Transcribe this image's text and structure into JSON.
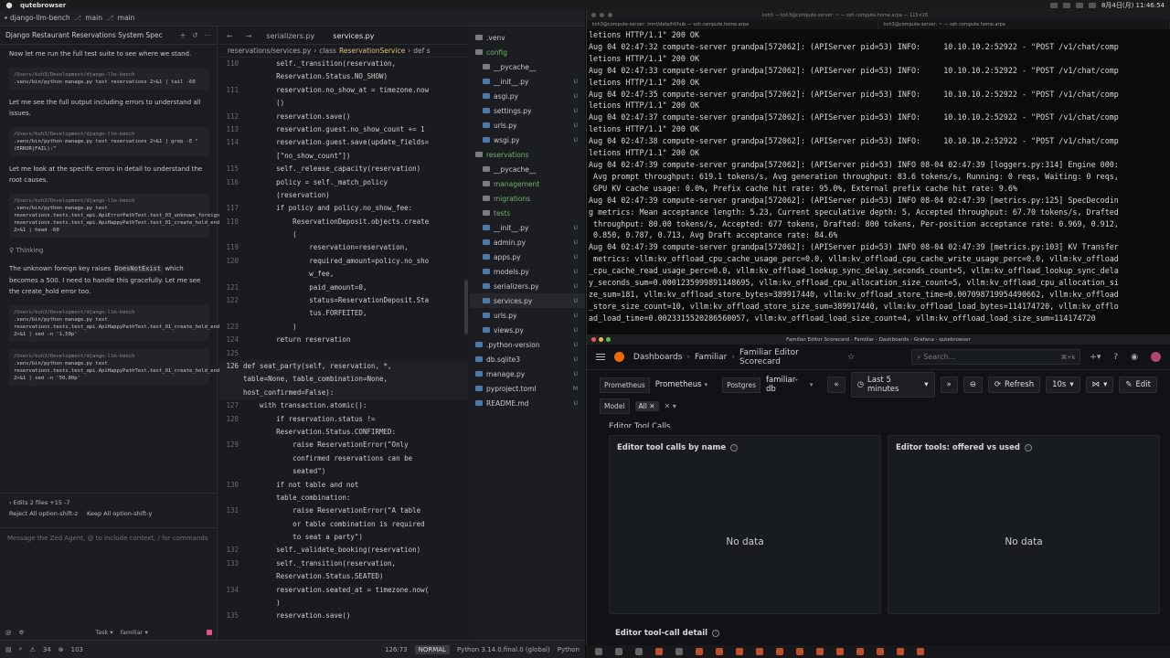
{
  "menubar": {
    "app_name": "qutebrowser",
    "clock": "8月4日(月) 11:46:54"
  },
  "zed": {
    "project": "django-llm-bench",
    "branch_label": "main",
    "branch2_label": "main"
  },
  "agent": {
    "title": "Django Restaurant Reservations System Spec",
    "messages": [
      "Now let me run the full test suite to see where we stand.",
      "Let me see the full output including errors to understand all issues.",
      "Let me look at the specific errors in detail to understand the root causes."
    ],
    "cmds": [
      {
        "cwd": "/Users/ksh3/Development/django-llm-bench",
        "text": ".venv/bin/python manage.py test reservations 2>&1 | tail -60"
      },
      {
        "cwd": "/Users/ksh3/Development/django-llm-bench",
        "text": ".venv/bin/python manage.py test reservations 2>&1 | grep -E \"(ERROR|FAIL):\""
      },
      {
        "cwd": "/Users/ksh3/Development/django-llm-bench",
        "text": ".venv/bin/python manage.py test reservations.tests.test_api.ApiErrorPathTest.test_03_unknown_foreign_key reservations.tests.test_api.ApiHappyPathTest.test_01_create_hold_endpoint 2>&1 | head -60"
      },
      {
        "cwd": "/Users/ksh3/Development/django-llm-bench",
        "text": ".venv/bin/python manage.py test reservations.tests.test_api.ApiHappyPathTest.test_01_create_hold_endpoint 2>&1 | sed -n '1,50p'"
      },
      {
        "cwd": "/Users/ksh3/Development/django-llm-bench",
        "text": ".venv/bin/python manage.py test reservations.tests.test_api.ApiHappyPathTest.test_01_create_hold_endpoint 2>&1 | sed -n '50,80p'"
      }
    ],
    "thinking": "Thinking",
    "paragraph_pre": "The unknown foreign key raises ",
    "paragraph_code": "DoesNotExist",
    "paragraph_post": " which becomes a 500. I need to handle this gracefully. Let me see the create_hold error too.",
    "edits": "Edits   2 files  +15 -7",
    "reject_all": "Reject All  option-shift-z",
    "keep_all": "Keep All  option-shift-y",
    "placeholder": "Message the Zed Agent, @ to include context, / for commands",
    "task": "Task",
    "model": "familiar"
  },
  "editor": {
    "tabs": [
      "serializers.py",
      "services.py"
    ],
    "breadcrumb_path": "reservations/services.py",
    "breadcrumb_class_kw": "class",
    "breadcrumb_class": "ReservationService",
    "breadcrumb_def": "def s",
    "lines": [
      {
        "n": "110",
        "t": "        self._transition(reservation,"
      },
      {
        "n": "",
        "t": "        Reservation.Status.NO_SHOW)"
      },
      {
        "n": "111",
        "t": "        reservation.no_show_at = timezone.now"
      },
      {
        "n": "",
        "t": "        ()"
      },
      {
        "n": "112",
        "t": "        reservation.save()"
      },
      {
        "n": "113",
        "t": "        reservation.guest.no_show_count += 1"
      },
      {
        "n": "114",
        "t": "        reservation.guest.save(update_fields="
      },
      {
        "n": "",
        "t": "        [\"no_show_count\"])"
      },
      {
        "n": "115",
        "t": "        self._release_capacity(reservation)"
      },
      {
        "n": "116",
        "t": "        policy = self._match_policy"
      },
      {
        "n": "",
        "t": "        (reservation)"
      },
      {
        "n": "117",
        "t": "        if policy and policy.no_show_fee:"
      },
      {
        "n": "118",
        "t": "            ReservationDeposit.objects.create"
      },
      {
        "n": "",
        "t": "            ("
      },
      {
        "n": "119",
        "t": "                reservation=reservation,"
      },
      {
        "n": "120",
        "t": "                required_amount=policy.no_sho"
      },
      {
        "n": "",
        "t": "                w_fee,"
      },
      {
        "n": "121",
        "t": "                paid_amount=0,"
      },
      {
        "n": "122",
        "t": "                status=ReservationDeposit.Sta"
      },
      {
        "n": "",
        "t": "                tus.FORFEITED,"
      },
      {
        "n": "123",
        "t": "            )"
      },
      {
        "n": "124",
        "t": "        return reservation"
      },
      {
        "n": "125",
        "t": ""
      },
      {
        "n": "126",
        "t": "def seat_party(self, reservation, *,"
      },
      {
        "n": "",
        "t": "table=None, table_combination=None,"
      },
      {
        "n": "",
        "t": "host_confirmed=False):"
      },
      {
        "n": "127",
        "t": "    with transaction.atomic():"
      },
      {
        "n": "128",
        "t": "        if reservation.status !="
      },
      {
        "n": "",
        "t": "        Reservation.Status.CONFIRMED:"
      },
      {
        "n": "129",
        "t": "            raise ReservationError(\"Only"
      },
      {
        "n": "",
        "t": "            confirmed reservations can be"
      },
      {
        "n": "",
        "t": "            seated\")"
      },
      {
        "n": "130",
        "t": "        if not table and not"
      },
      {
        "n": "",
        "t": "        table_combination:"
      },
      {
        "n": "131",
        "t": "            raise ReservationError(\"A table"
      },
      {
        "n": "",
        "t": "            or table combination is required"
      },
      {
        "n": "",
        "t": "            to seat a party\")"
      },
      {
        "n": "132",
        "t": "        self._validate_booking(reservation)"
      },
      {
        "n": "133",
        "t": "        self._transition(reservation,"
      },
      {
        "n": "",
        "t": "        Reservation.Status.SEATED)"
      },
      {
        "n": "134",
        "t": "        reservation.seated_at = timezone.now("
      },
      {
        "n": "",
        "t": "        )"
      },
      {
        "n": "135",
        "t": "        reservation.save()"
      }
    ]
  },
  "project": {
    "items": [
      {
        "name": ".venv",
        "kind": "dir",
        "depth": 0,
        "status": ""
      },
      {
        "name": "config",
        "kind": "dir-open",
        "depth": 0,
        "status": ""
      },
      {
        "name": "__pycache__",
        "kind": "dir",
        "depth": 1,
        "status": ""
      },
      {
        "name": "__init__.py",
        "kind": "file",
        "depth": 1,
        "status": "U"
      },
      {
        "name": "asgi.py",
        "kind": "file",
        "depth": 1,
        "status": "U"
      },
      {
        "name": "settings.py",
        "kind": "file",
        "depth": 1,
        "status": "U"
      },
      {
        "name": "urls.py",
        "kind": "file",
        "depth": 1,
        "status": "U"
      },
      {
        "name": "wsgi.py",
        "kind": "file",
        "depth": 1,
        "status": "U"
      },
      {
        "name": "reservations",
        "kind": "dir-open",
        "depth": 0,
        "status": ""
      },
      {
        "name": "__pycache__",
        "kind": "dir",
        "depth": 1,
        "status": ""
      },
      {
        "name": "management",
        "kind": "dir-open",
        "depth": 1,
        "status": ""
      },
      {
        "name": "migrations",
        "kind": "dir-open",
        "depth": 1,
        "status": ""
      },
      {
        "name": "tests",
        "kind": "dir-open",
        "depth": 1,
        "status": ""
      },
      {
        "name": "__init__.py",
        "kind": "file",
        "depth": 1,
        "status": "U"
      },
      {
        "name": "admin.py",
        "kind": "file",
        "depth": 1,
        "status": "U"
      },
      {
        "name": "apps.py",
        "kind": "file",
        "depth": 1,
        "status": "U"
      },
      {
        "name": "models.py",
        "kind": "file",
        "depth": 1,
        "status": "U"
      },
      {
        "name": "serializers.py",
        "kind": "file",
        "depth": 1,
        "status": "U"
      },
      {
        "name": "services.py",
        "kind": "file",
        "depth": 1,
        "status": "U"
      },
      {
        "name": "urls.py",
        "kind": "file",
        "depth": 1,
        "status": "U"
      },
      {
        "name": "views.py",
        "kind": "file",
        "depth": 1,
        "status": "U"
      },
      {
        "name": ".python-version",
        "kind": "file",
        "depth": 0,
        "status": "U"
      },
      {
        "name": "db.sqlite3",
        "kind": "file",
        "depth": 0,
        "status": "U"
      },
      {
        "name": "manage.py",
        "kind": "file",
        "depth": 0,
        "status": "U"
      },
      {
        "name": "pyproject.toml",
        "kind": "file",
        "depth": 0,
        "status": "M"
      },
      {
        "name": "README.md",
        "kind": "file",
        "depth": 0,
        "status": "U"
      }
    ]
  },
  "statusbar": {
    "warnings": "34",
    "errors": "103",
    "position": "126:73",
    "mode": "NORMAL",
    "python": "Python 3.14.0.final.0 (global)",
    "lang": "Python"
  },
  "terminal": {
    "title": "ksh3 — ksh3@compute-server: ~ — ssh compute.home.arpa — 115×26",
    "tab1": "ksh3@compute-server: /mnt/data/hf/hub — ssh compute.home.arpa",
    "tab2": "ksh3@compute-server: ~ — ssh compute.home.arpa",
    "lines": [
      "letions HTTP/1.1\" 200 OK",
      "Aug 04 02:47:32 compute-server grandpa[572062]: (APIServer pid=53) INFO:     10.10.10.2:52922 - \"POST /v1/chat/comp",
      "letions HTTP/1.1\" 200 OK",
      "Aug 04 02:47:33 compute-server grandpa[572062]: (APIServer pid=53) INFO:     10.10.10.2:52922 - \"POST /v1/chat/comp",
      "letions HTTP/1.1\" 200 OK",
      "Aug 04 02:47:35 compute-server grandpa[572062]: (APIServer pid=53) INFO:     10.10.10.2:52922 - \"POST /v1/chat/comp",
      "letions HTTP/1.1\" 200 OK",
      "Aug 04 02:47:37 compute-server grandpa[572062]: (APIServer pid=53) INFO:     10.10.10.2:52922 - \"POST /v1/chat/comp",
      "letions HTTP/1.1\" 200 OK",
      "Aug 04 02:47:38 compute-server grandpa[572062]: (APIServer pid=53) INFO:     10.10.10.2:52922 - \"POST /v1/chat/comp",
      "letions HTTP/1.1\" 200 OK",
      "Aug 04 02:47:39 compute-server grandpa[572062]: (APIServer pid=53) INFO 08-04 02:47:39 [loggers.py:314] Engine 000:",
      " Avg prompt throughput: 619.1 tokens/s, Avg generation throughput: 83.6 tokens/s, Running: 0 reqs, Waiting: 0 reqs,",
      " GPU KV cache usage: 0.0%, Prefix cache hit rate: 95.0%, External prefix cache hit rate: 9.6%",
      "Aug 04 02:47:39 compute-server grandpa[572062]: (APIServer pid=53) INFO 08-04 02:47:39 [metrics.py:125] SpecDecodin",
      "g metrics: Mean acceptance length: 5.23, Current speculative depth: 5, Accepted throughput: 67.70 tokens/s, Drafted",
      " throughput: 80.00 tokens/s, Accepted: 677 tokens, Drafted: 800 tokens, Per-position acceptance rate: 0.969, 0.912,",
      " 0.850, 0.787, 0.713, Avg Draft acceptance rate: 84.6%",
      "Aug 04 02:47:39 compute-server grandpa[572062]: (APIServer pid=53) INFO 08-04 02:47:39 [metrics.py:103] KV Transfer",
      " metrics: vllm:kv_offload_cpu_cache_usage_perc=0.0, vllm:kv_offload_cpu_cache_write_usage_perc=0.0, vllm:kv_offload",
      "_cpu_cache_read_usage_perc=0.0, vllm:kv_offload_lookup_sync_delay_seconds_count=5, vllm:kv_offload_lookup_sync_dela",
      "y_seconds_sum=0.0001235999891148695, vllm:kv_offload_cpu_allocation_size_count=5, vllm:kv_offload_cpu_allocation_si",
      "ze_sum=181, vllm:kv_offload_store_bytes=389917440, vllm:kv_offload_store_time=0.007098719954490662, vllm:kv_offload",
      "_store_size_count=10, vllm:kv_offload_store_size_sum=389917440, vllm:kv_offload_load_bytes=114174720, vllm:kv_offlo",
      "ad_load_time=0.0023315520286560057, vllm:kv_offload_load_size_count=4, vllm:kv_offload_load_size_sum=114174720"
    ]
  },
  "grafana": {
    "window_title": "Familiar Editor Scorecard - Familiar - Dashboards - Grafana - qutebrowser",
    "breadcrumb": [
      "Dashboards",
      "Familiar",
      "Familiar Editor Scorecard"
    ],
    "search_placeholder": "Search...",
    "search_shortcut": "⌘+k",
    "vars": [
      {
        "label": "Prometheus",
        "value": "Prometheus"
      },
      {
        "label": "Postgres",
        "value": "familiar-db"
      }
    ],
    "time_range": "Last 5 minutes",
    "refresh": "Refresh",
    "refresh_interval": "10s",
    "edit": "Edit",
    "model_label": "Model",
    "model_value": "All",
    "row_title": "Editor Tool Calls",
    "panels": [
      {
        "title": "Editor tool calls by name",
        "status": "No data"
      },
      {
        "title": "Editor tools: offered vs used",
        "status": "No data"
      }
    ],
    "bottom_panel_title": "Editor tool-call detail"
  }
}
